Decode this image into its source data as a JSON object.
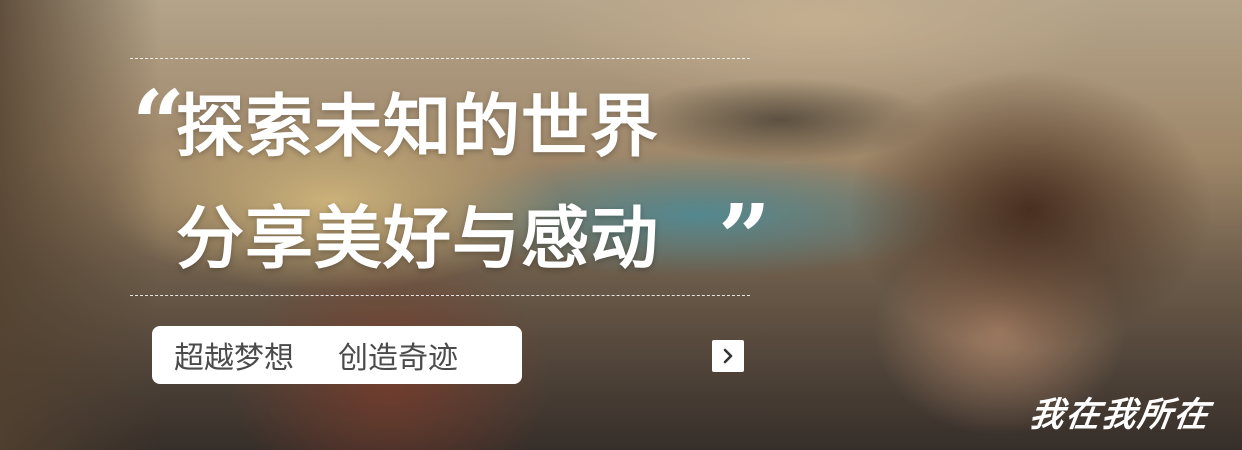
{
  "banner": {
    "quote_open": "“",
    "quote_close": "”",
    "headline_line1": "探索未知的世界",
    "headline_line2": "分享美好与感动",
    "tagline_left": "超越梦想",
    "tagline_right": "创造奇迹",
    "next_icon": "chevron-right-icon",
    "signature": "我在我所在"
  },
  "colors": {
    "text": "#ffffff",
    "pill_background": "#ffffff",
    "pill_text": "#4b4b4b"
  }
}
